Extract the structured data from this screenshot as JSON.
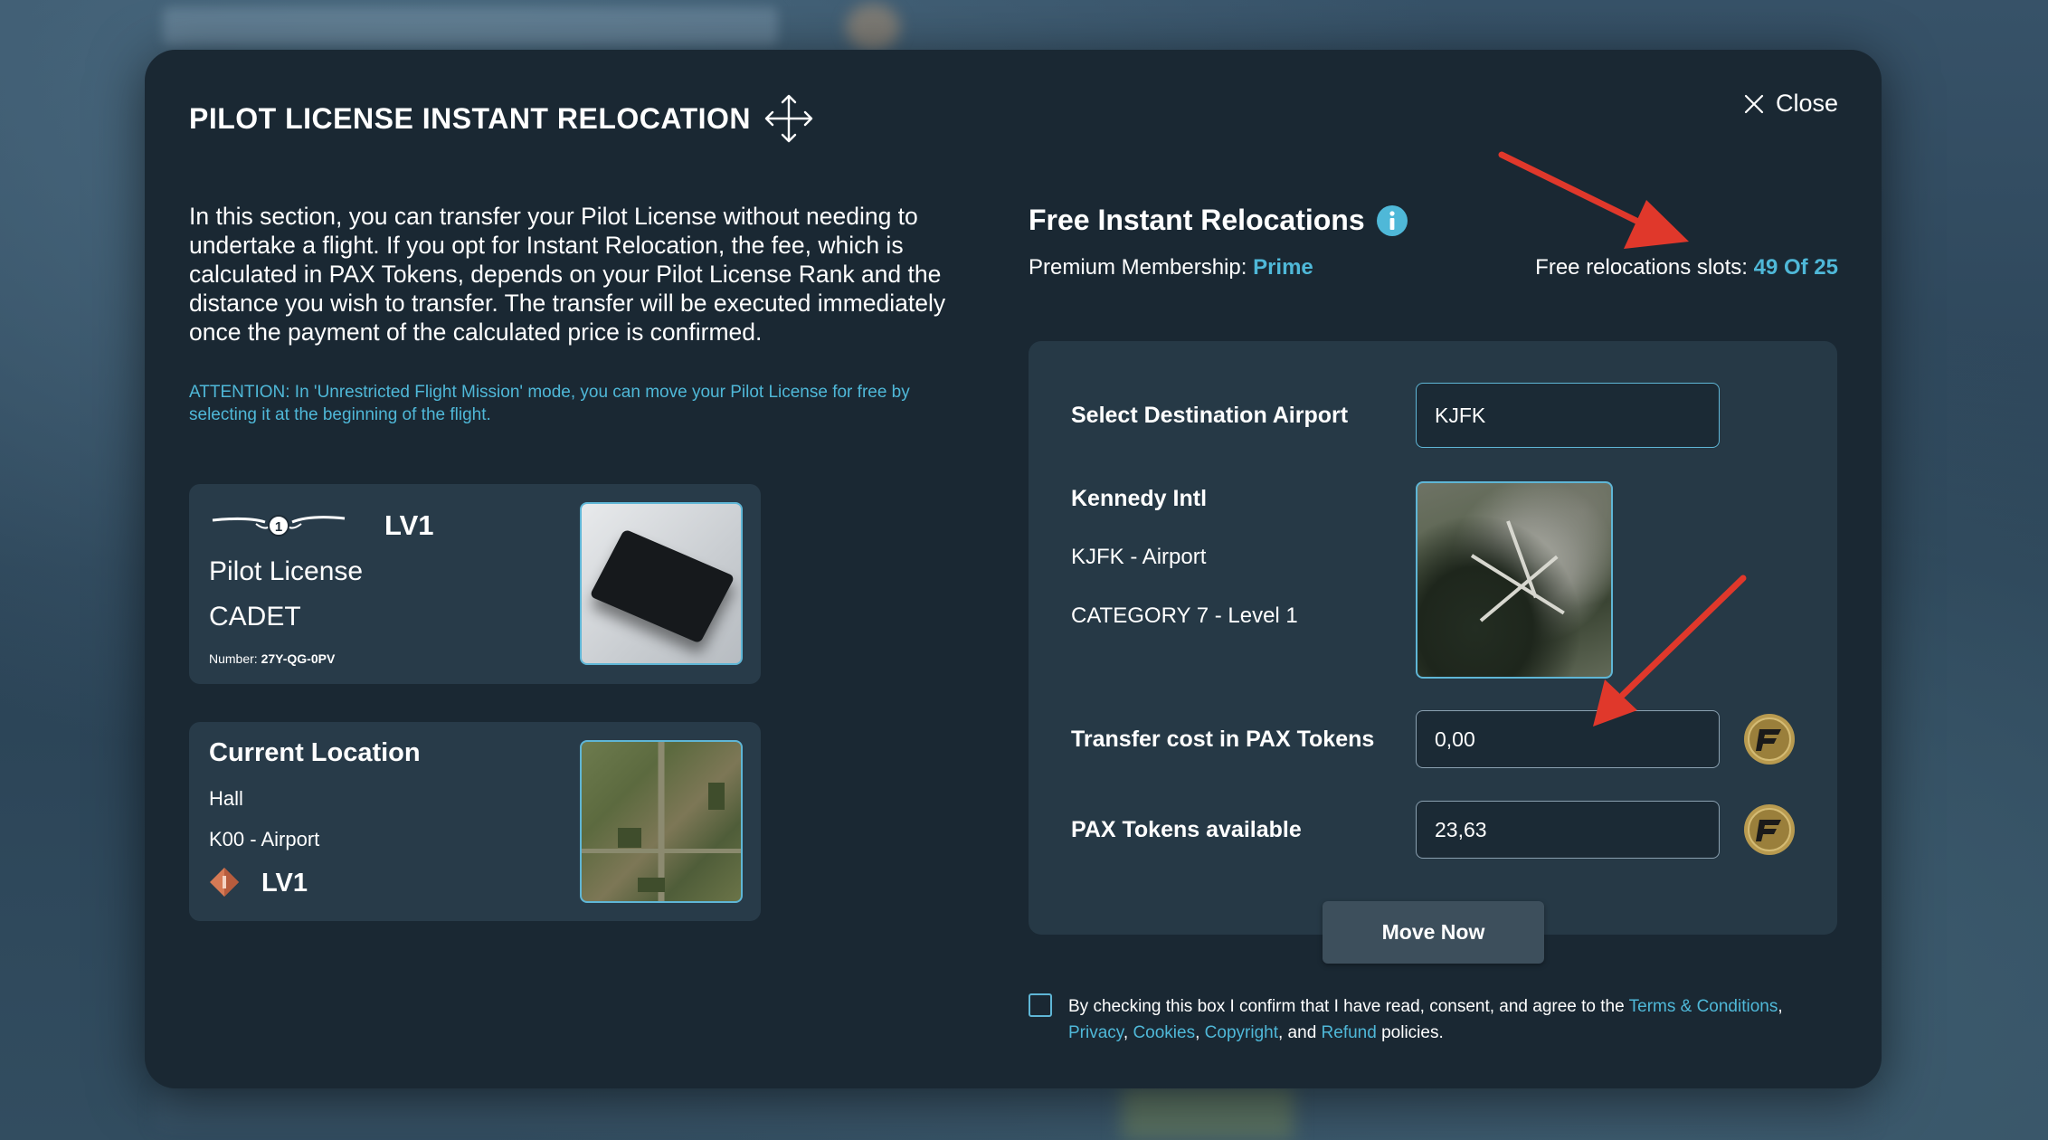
{
  "modal": {
    "title": "PILOT LICENSE INSTANT RELOCATION",
    "close_label": "Close",
    "intro": "In this section, you can transfer your Pilot License without needing to undertake a flight. If you opt for Instant Relocation, the fee, which is calculated in PAX Tokens, depends on your Pilot License Rank and the distance you wish to transfer. The transfer will be executed immediately once the payment of the calculated price is confirmed.",
    "attention": "ATTENTION: In 'Unrestricted Flight Mission' mode, you can move your Pilot License for free by selecting it at the beginning of the flight."
  },
  "license": {
    "level": "LV1",
    "wings_badge": "1",
    "name": "Pilot License",
    "rank": "CADET",
    "number_label": "Number:",
    "number": "27Y-QG-0PV"
  },
  "location": {
    "title": "Current Location",
    "city": "Hall",
    "code": "K00 - Airport",
    "level": "LV1"
  },
  "relocations": {
    "title": "Free Instant Relocations",
    "membership_label": "Premium Membership:",
    "membership_value": "Prime",
    "slots_label": "Free relocations slots:",
    "slots_value": "49 Of 25"
  },
  "destination": {
    "label": "Select Destination Airport",
    "value": "KJFK",
    "airport_name": "Kennedy Intl",
    "airport_code": "KJFK - Airport",
    "category": "CATEGORY 7 - Level 1"
  },
  "cost": {
    "transfer_label": "Transfer cost in PAX Tokens",
    "transfer_value": "0,00",
    "available_label": "PAX Tokens available",
    "available_value": "23,63"
  },
  "actions": {
    "move_now": "Move Now"
  },
  "consent": {
    "text_before": "By checking this box I confirm that I have read, consent, and agree to the ",
    "terms": "Terms & Conditions",
    "privacy": "Privacy",
    "cookies": "Cookies",
    "copyright": "Copyright",
    "and": ", and ",
    "refund": "Refund",
    "policies": " policies."
  },
  "colors": {
    "accent": "#4fb8d8",
    "modal_bg": "#1a2833",
    "card_bg": "#283b49",
    "arrow": "#e0382b"
  }
}
